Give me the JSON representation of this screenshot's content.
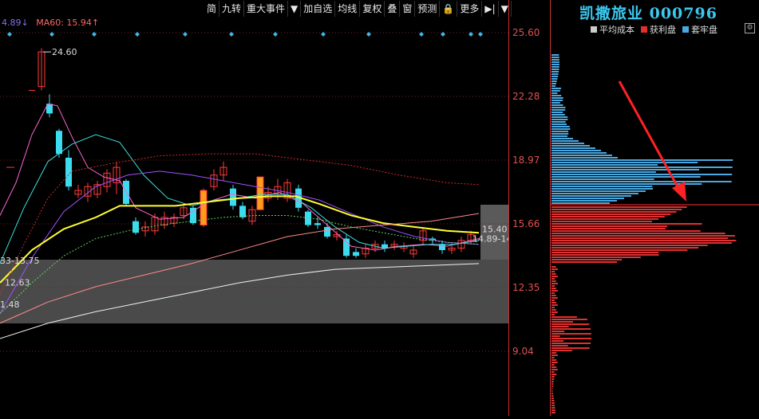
{
  "toolbar": {
    "items": [
      "简",
      "九转",
      "重大事件",
      "▼",
      "加自选",
      "均线",
      "复权",
      "叠",
      "窗",
      "预测",
      "🔒",
      "更多",
      "▶|",
      "▼"
    ]
  },
  "legend": {
    "ma_prev": "4.89↓",
    "ma60": "MA60: 15.94↑"
  },
  "price_axis": [
    "25.60",
    "22.28",
    "18.97",
    "15.66",
    "12.35",
    "9.04"
  ],
  "annotations": {
    "high": "24.60",
    "a1": "15.40",
    "a2": "14.89-14",
    "left1": "33-13.75",
    "left2": "12.63",
    "left3": "1.48"
  },
  "stock": {
    "title": "凯撒旅业 000796"
  },
  "dist_legend": {
    "avg": "平均成本",
    "profit": "获利盘",
    "locked": "套牢盘"
  },
  "colors": {
    "up": "#ff3b3b",
    "down": "#3cdcf0",
    "avg": "#cccccc",
    "profit": "#e03030",
    "locked": "#4aa8e0",
    "accent": "#3cc8f0"
  }
}
